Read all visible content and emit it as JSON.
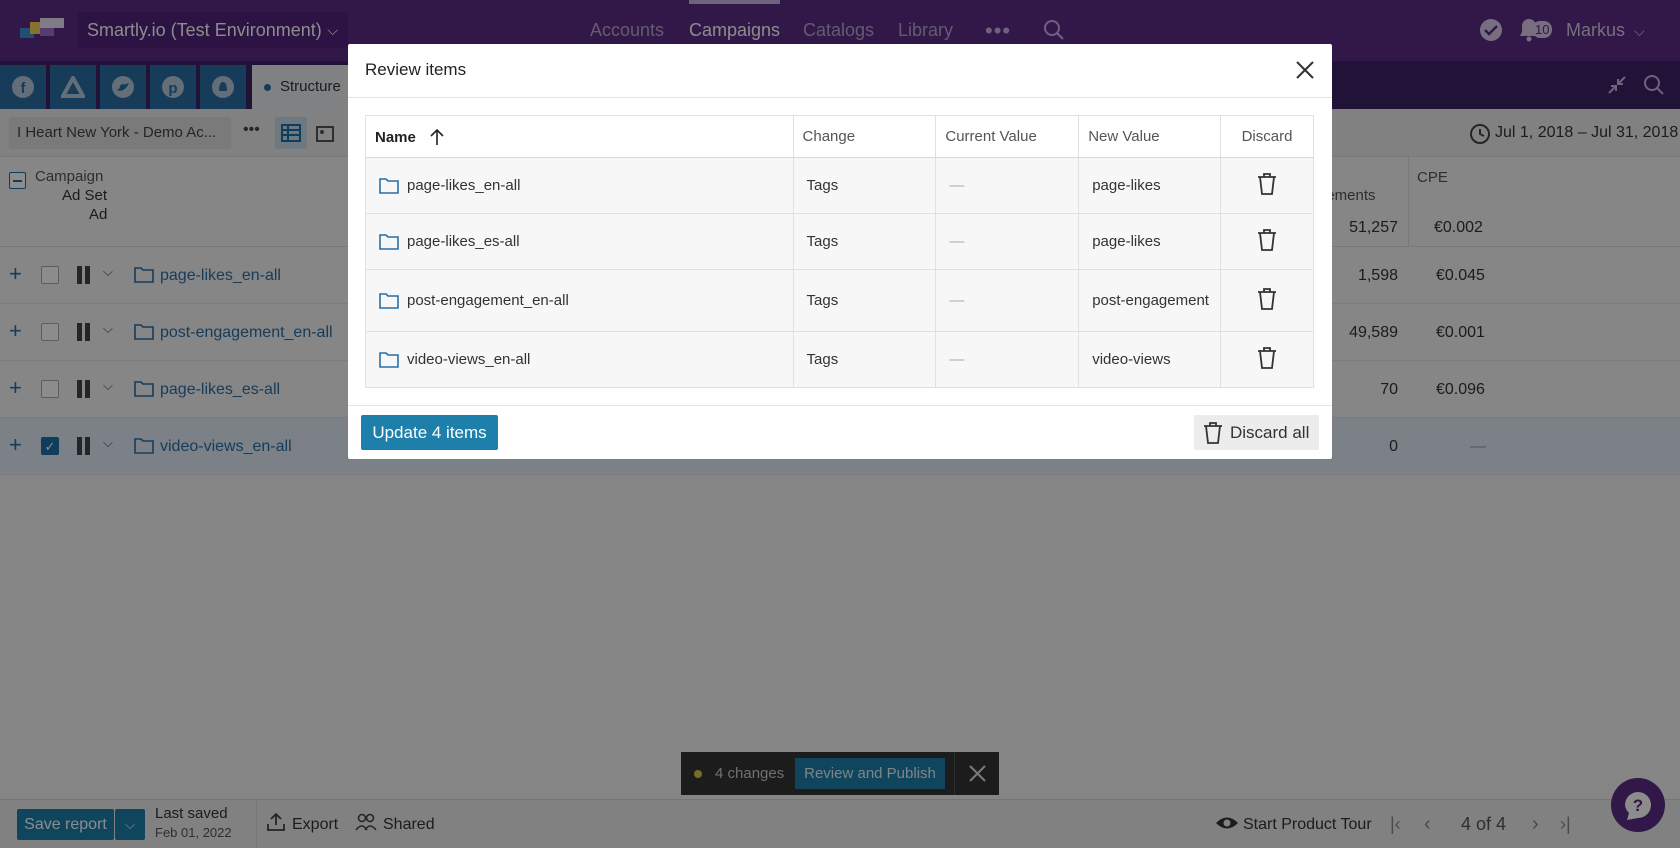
{
  "topbar": {
    "account_name": "Smartly.io (Test Environment)",
    "nav": [
      "Accounts",
      "Campaigns",
      "Catalogs",
      "Library"
    ],
    "active_nav": "Campaigns",
    "notification_count": "10",
    "user": "Markus"
  },
  "subbar": {
    "networks": [
      "facebook-icon",
      "adwords-icon",
      "twitter-icon",
      "pinterest-icon",
      "snapchat-icon"
    ],
    "tab_label": "Structure"
  },
  "toolbar": {
    "breadcrumb": "I Heart New York - Demo Ac...",
    "date_range": "Jul 1, 2018 – Jul 31, 2018"
  },
  "table": {
    "tree_levels": [
      "Campaign",
      "Ad Set",
      "Ad"
    ],
    "col_engagements": "gements",
    "col_cpe": "CPE",
    "totals": {
      "engagements": "51,257",
      "cpe": "€0.002"
    },
    "rows": [
      {
        "name": "page-likes_en-all",
        "engagements": "1,598",
        "cpe": "€0.045",
        "checked": false
      },
      {
        "name": "post-engagement_en-all",
        "engagements": "49,589",
        "cpe": "€0.001",
        "checked": false
      },
      {
        "name": "page-likes_es-all",
        "engagements": "70",
        "cpe": "€0.096",
        "checked": false
      },
      {
        "name": "video-views_en-all",
        "engagements": "0",
        "cpe": "—",
        "checked": true
      }
    ]
  },
  "modal": {
    "title": "Review items",
    "columns": {
      "name": "Name",
      "change": "Change",
      "current": "Current Value",
      "new": "New Value",
      "discard": "Discard"
    },
    "items": [
      {
        "name": "page-likes_en-all",
        "change": "Tags",
        "current": "—",
        "new": "page-likes"
      },
      {
        "name": "page-likes_es-all",
        "change": "Tags",
        "current": "—",
        "new": "page-likes"
      },
      {
        "name": "post-engagement_en-all",
        "change": "Tags",
        "current": "—",
        "new": "post-engagement"
      },
      {
        "name": "video-views_en-all",
        "change": "Tags",
        "current": "—",
        "new": "video-views"
      }
    ],
    "update_label": "Update 4 items",
    "discard_all_label": "Discard all"
  },
  "changes_bar": {
    "count_text": "4 changes",
    "review_label": "Review and Publish"
  },
  "footer": {
    "save_label": "Save report",
    "last_saved_label": "Last saved",
    "last_saved_date": "Feb 01, 2022",
    "export_label": "Export",
    "shared_label": "Shared",
    "tour_label": "Start Product Tour",
    "pager": "4 of 4"
  }
}
